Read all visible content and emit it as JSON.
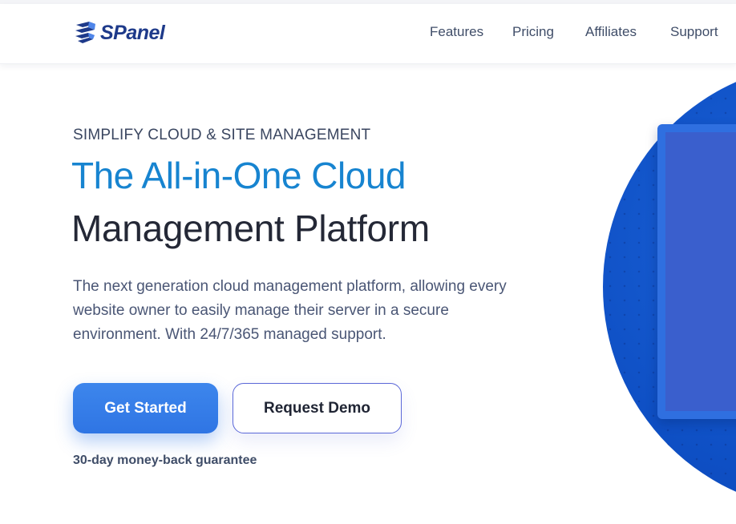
{
  "header": {
    "logo_text": "SPanel",
    "nav": [
      {
        "label": "Features"
      },
      {
        "label": "Pricing"
      },
      {
        "label": "Affiliates"
      },
      {
        "label": "Support"
      }
    ]
  },
  "hero": {
    "eyebrow": "SIMPLIFY CLOUD & SITE MANAGEMENT",
    "headline_line1": "The All-in-One Cloud",
    "headline_line2": "Management Platform",
    "description": "The next generation cloud management platform, allowing every website owner to easily manage their server in a secure environment. With 24/7/365 managed support.",
    "primary_cta": "Get Started",
    "secondary_cta": "Request Demo",
    "guarantee": "30-day money-back guarantee"
  },
  "colors": {
    "accent_blue": "#1784d0",
    "button_blue": "#2f75e4",
    "dark_text": "#242836",
    "logo_blue": "#1e3a8a"
  },
  "icons": {
    "logo": "spanel-shield-icon"
  }
}
